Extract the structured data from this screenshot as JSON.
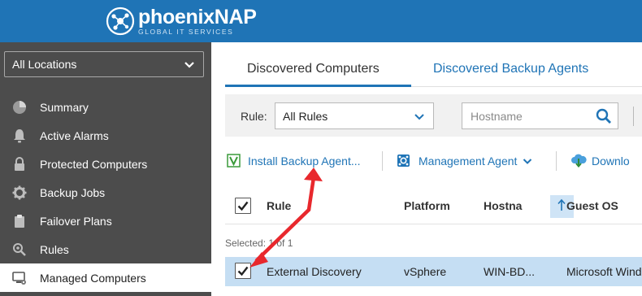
{
  "header": {
    "brand_name": "phoenixNAP",
    "brand_tagline": "GLOBAL IT SERVICES",
    "background_color": "#1f74b6"
  },
  "sidebar": {
    "location_select": {
      "value": "All Locations"
    },
    "items": [
      {
        "label": "Summary",
        "icon": "pie-chart-icon",
        "active": false
      },
      {
        "label": "Active Alarms",
        "icon": "bell-icon",
        "active": false
      },
      {
        "label": "Protected Computers",
        "icon": "lock-icon",
        "active": false
      },
      {
        "label": "Backup Jobs",
        "icon": "gear-icon",
        "active": false
      },
      {
        "label": "Failover Plans",
        "icon": "clipboard-icon",
        "active": false
      },
      {
        "label": "Rules",
        "icon": "rules-icon",
        "active": false
      },
      {
        "label": "Managed Computers",
        "icon": "computer-icon",
        "active": true
      }
    ]
  },
  "tabs": [
    {
      "label": "Discovered Computers",
      "active": true
    },
    {
      "label": "Discovered Backup Agents",
      "active": false
    }
  ],
  "filter": {
    "rule_label": "Rule:",
    "rule_value": "All Rules",
    "hostname_placeholder": "Hostname"
  },
  "toolbar": {
    "install_label": "Install Backup Agent...",
    "management_label": "Management Agent",
    "download_label": "Downlo"
  },
  "table": {
    "columns": [
      "Rule",
      "Platform",
      "Hostna",
      "Guest OS"
    ],
    "selection_text": "Selected: 1 of 1",
    "rows": [
      {
        "checked": true,
        "rule": "External Discovery",
        "platform": "vSphere",
        "hostname": "WIN-BD...",
        "guest_os": "Microsoft Wind"
      }
    ]
  },
  "colors": {
    "accent": "#1f74b6",
    "sidebar": "#4c4c4c",
    "selected_row": "#c5def3",
    "annotation_arrow": "#e8282d"
  }
}
